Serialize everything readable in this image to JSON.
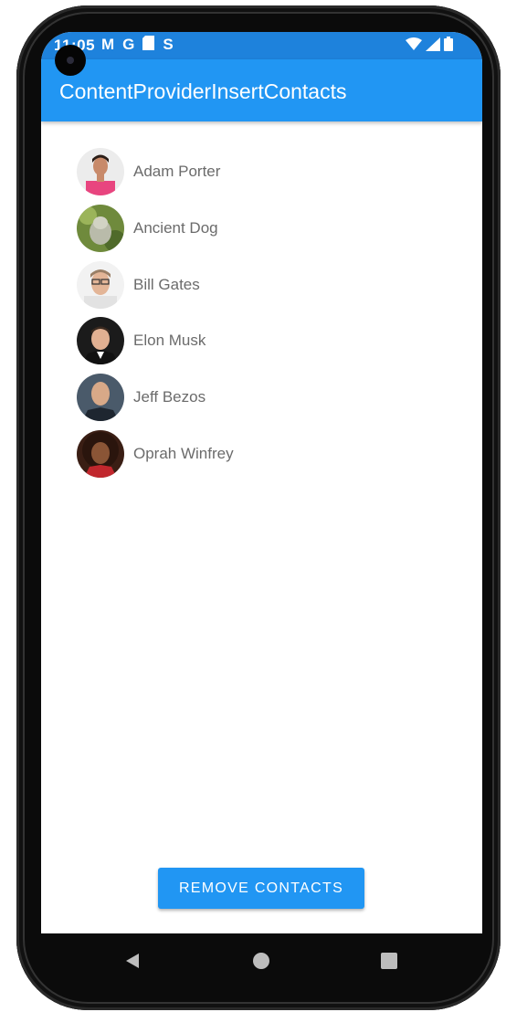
{
  "status_bar": {
    "time": "11:05",
    "left_icons": [
      "gmail-icon",
      "google-icon",
      "sd-card-icon",
      "sync-icon"
    ],
    "right_icons": [
      "wifi-icon",
      "signal-icon",
      "battery-icon"
    ]
  },
  "app_bar": {
    "title": "ContentProviderInsertContacts"
  },
  "contacts": [
    {
      "name": "Adam Porter",
      "avatar": "photo"
    },
    {
      "name": "Ancient Dog",
      "avatar": "photo"
    },
    {
      "name": "Bill Gates",
      "avatar": "photo"
    },
    {
      "name": "Elon Musk",
      "avatar": "photo"
    },
    {
      "name": "Jeff Bezos",
      "avatar": "photo"
    },
    {
      "name": "Oprah Winfrey",
      "avatar": "photo"
    }
  ],
  "actions": {
    "remove_label": "REMOVE CONTACTS"
  },
  "navigation": {
    "back": "back-icon",
    "home": "home-icon",
    "recents": "recents-icon"
  },
  "colors": {
    "primary": "#2196f3",
    "status_bar": "#1e82dc",
    "contact_text": "#6b6b6b"
  }
}
